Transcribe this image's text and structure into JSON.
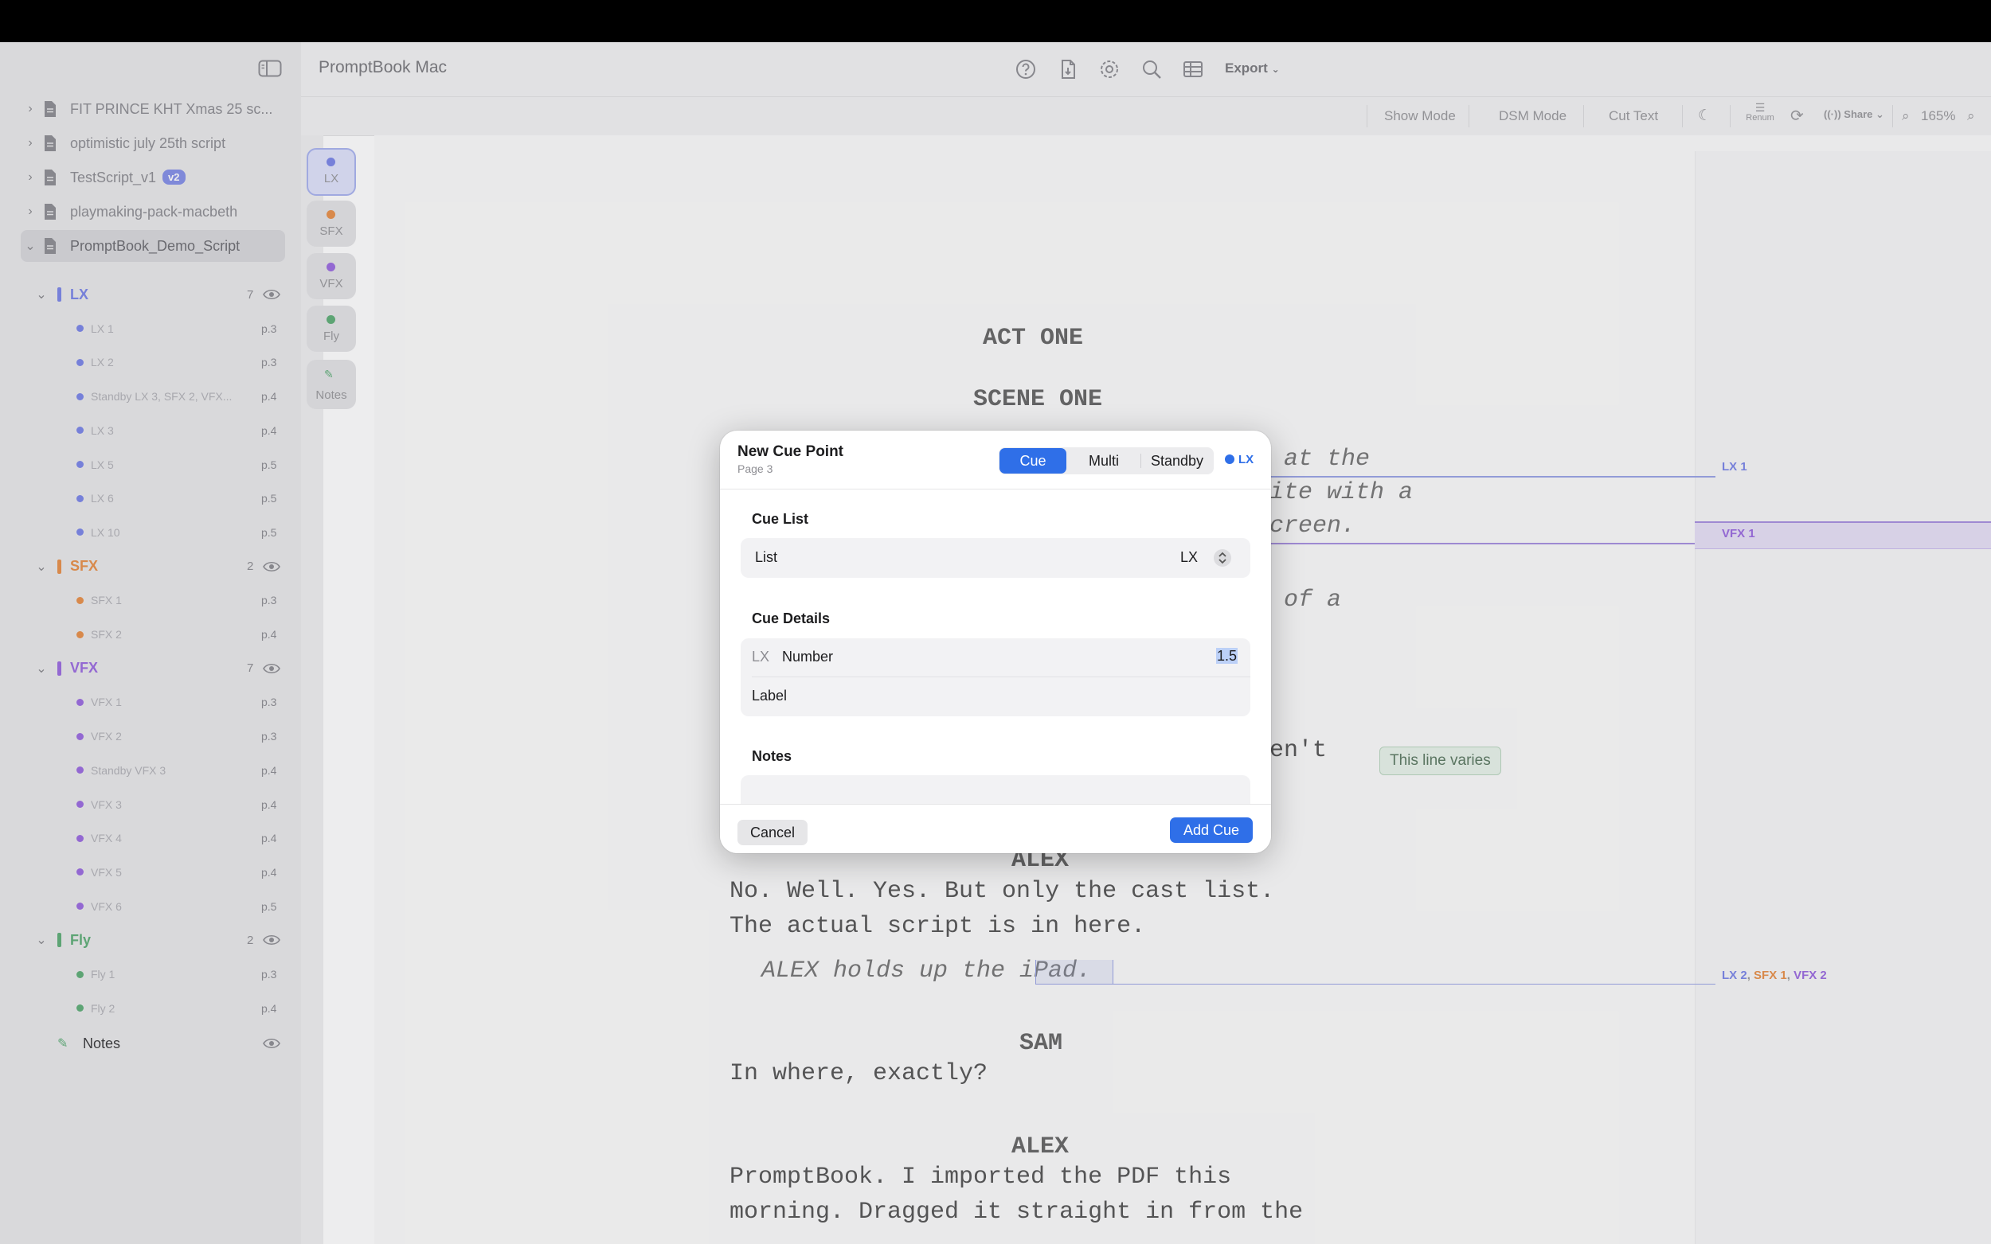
{
  "app": {
    "title": "PromptBook Mac"
  },
  "header": {
    "export_label": "Export"
  },
  "toolbar": {
    "show_mode": "Show Mode",
    "dsm_mode": "DSM Mode",
    "cut_text": "Cut Text",
    "renum": "Renum",
    "share": "Share",
    "zoom": "165%"
  },
  "sidebar": {
    "scripts": [
      {
        "name": "FIT PRINCE KHT Xmas 25 sc..."
      },
      {
        "name": "optimistic july 25th script"
      },
      {
        "name": "TestScript_v1",
        "badge": "v2"
      },
      {
        "name": "playmaking-pack-macbeth"
      },
      {
        "name": "PromptBook_Demo_Script",
        "selected": true
      }
    ],
    "groups": [
      {
        "name": "LX",
        "count": "7",
        "color": "#7b86e8",
        "cues": [
          {
            "name": "LX 1",
            "page": "p.3"
          },
          {
            "name": "LX 2",
            "page": "p.3"
          },
          {
            "name": "Standby LX 3, SFX 2, VFX...",
            "page": "p.4"
          },
          {
            "name": "LX 3",
            "page": "p.4"
          },
          {
            "name": "LX 5",
            "page": "p.5"
          },
          {
            "name": "LX 6",
            "page": "p.5"
          },
          {
            "name": "LX 10",
            "page": "p.5"
          }
        ]
      },
      {
        "name": "SFX",
        "count": "2",
        "color": "#e8904a",
        "cues": [
          {
            "name": "SFX 1",
            "page": "p.3"
          },
          {
            "name": "SFX 2",
            "page": "p.4"
          }
        ]
      },
      {
        "name": "VFX",
        "count": "7",
        "color": "#9b6be0",
        "cues": [
          {
            "name": "VFX 1",
            "page": "p.3"
          },
          {
            "name": "VFX 2",
            "page": "p.3"
          },
          {
            "name": "Standby VFX 3",
            "page": "p.4"
          },
          {
            "name": "VFX 3",
            "page": "p.4"
          },
          {
            "name": "VFX 4",
            "page": "p.4"
          },
          {
            "name": "VFX 5",
            "page": "p.4"
          },
          {
            "name": "VFX 6",
            "page": "p.5"
          }
        ]
      },
      {
        "name": "Fly",
        "count": "2",
        "color": "#5fae78",
        "cues": [
          {
            "name": "Fly 1",
            "page": "p.3"
          },
          {
            "name": "Fly 2",
            "page": "p.4"
          }
        ]
      }
    ],
    "notes_label": "Notes"
  },
  "cue_types": [
    {
      "label": "LX",
      "color": "#7b86e8"
    },
    {
      "label": "SFX",
      "color": "#e8904a"
    },
    {
      "label": "VFX",
      "color": "#9b6be0"
    },
    {
      "label": "Fly",
      "color": "#5fae78"
    },
    {
      "label": "Notes",
      "color": "#5fae78"
    }
  ],
  "script": {
    "act": "ACT ONE",
    "scene": "SCENE ONE",
    "line1": "s at the",
    "line2": "site with a",
    "line3": "screen.",
    "line4": "n of a",
    "line5": "ven't",
    "varies": "This line varies",
    "char1": "ALEX",
    "dlg1a": "No. Well. Yes. But only the cast list.",
    "dlg1b": "The actual script is in here.",
    "dir1": "ALEX holds up the iPad.",
    "char2": "SAM",
    "dlg2": "In where, exactly?",
    "char3": "ALEX",
    "dlg3a": "PromptBook. I imported the PDF this",
    "dlg3b": "morning. Dragged it straight in from the",
    "tag_lx1": "LX 1",
    "tag_vfx1": "VFX 1",
    "tag_lx2": "LX 2",
    "tag_sfx1": "SFX 1",
    "tag_vfx2": "VFX 2",
    "tag_sep": ", "
  },
  "modal": {
    "title": "New Cue Point",
    "subtitle": "Page 3",
    "segments": [
      "Cue",
      "Multi",
      "Standby"
    ],
    "list_indicator": "LX",
    "cue_list_heading": "Cue List",
    "list_label": "List",
    "list_value": "LX",
    "cue_details_heading": "Cue Details",
    "prefix": "LX",
    "number_label": "Number",
    "number_value": "1.5",
    "label_label": "Label",
    "notes_heading": "Notes",
    "cancel": "Cancel",
    "add": "Add Cue"
  }
}
